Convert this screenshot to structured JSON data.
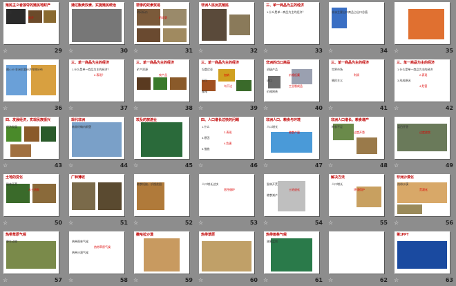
{
  "slides": [
    {
      "n": "29",
      "title": "殖民主义者掠夺的殖民地财产",
      "caps": [
        "黄金",
        "象牙"
      ]
    },
    {
      "n": "30",
      "title": "通过贩卖奴隶，实施殖民统治",
      "caps": []
    },
    {
      "n": "31",
      "title": "悲惨的奴隶贸易",
      "caps": [
        "明码标价",
        "的奴隶"
      ]
    },
    {
      "n": "32",
      "title": "非洲人民反抗殖民",
      "caps": []
    },
    {
      "n": "33",
      "title": "三、单一商品为主的经济",
      "caps": [
        "1.什么是单一商品为主的经济？"
      ]
    },
    {
      "n": "34",
      "title": "",
      "caps": [
        "非洲主要出口商品占出口总值"
      ]
    },
    {
      "n": "35",
      "title": "",
      "caps": []
    },
    {
      "n": "36",
      "title": "",
      "caps": [
        "图4.49 非洲主要经济作物分布"
      ]
    },
    {
      "n": "37",
      "title": "三、单一商品为主的经济",
      "caps": [
        "1.什么是单一商品为主的经济？",
        "2.表现？"
      ]
    },
    {
      "n": "38",
      "title": "三、单一商品为主的经济",
      "caps": [
        "矿产资源",
        "农产品"
      ]
    },
    {
      "n": "39",
      "title": "三、单一商品为主的经济",
      "caps": [
        "坦桑尼亚",
        "加纳",
        "可可",
        "乌干达",
        "咖啡"
      ]
    },
    {
      "n": "40",
      "title": "非洲的出口商品",
      "caps": [
        "初级产品",
        "价格低廉",
        "进口",
        "工业制成品",
        "价格昂贵"
      ]
    },
    {
      "n": "41",
      "title": "三、单一商品为主的经济",
      "caps": [
        "世界市场",
        "利润",
        "殖民主义"
      ]
    },
    {
      "n": "42",
      "title": "三、单一商品为主的经济",
      "caps": [
        "1.什么是单一商品为主的经济",
        "2.表现",
        "3.形成原因",
        "4.危害"
      ]
    },
    {
      "n": "43",
      "title": "四、发展经济，实现民族振兴",
      "caps": [
        "经济发展"
      ]
    },
    {
      "n": "44",
      "title": "现代非洲",
      "caps": [
        "南非约翰内斯堡"
      ]
    },
    {
      "n": "45",
      "title": "埃及的旅游业",
      "caps": []
    },
    {
      "n": "46",
      "title": "四、人口增长过快的问题",
      "caps": [
        "1.什么",
        "2.表现",
        "3.原因",
        "4.危害",
        "5.措施"
      ]
    },
    {
      "n": "47",
      "title": "非洲人口、粮食与环境",
      "caps": [
        "人口增长",
        "粮食产量"
      ]
    },
    {
      "n": "48",
      "title": "非洲人口增长、粮食增产",
      "caps": [
        "粮食不足",
        "过度开垦"
      ]
    },
    {
      "n": "49",
      "title": "",
      "caps": [
        "盲目开垦",
        "过度放牧"
      ]
    },
    {
      "n": "50",
      "title": "土地的变化",
      "caps": [
        "毁林开荒",
        "水土流失"
      ]
    },
    {
      "n": "51",
      "title": "广种薄收",
      "caps": []
    },
    {
      "n": "52",
      "title": "",
      "caps": [
        "粮食短缺、饥饿贫困"
      ]
    },
    {
      "n": "53",
      "title": "",
      "caps": [
        "人口增长过快",
        "恶性循环"
      ]
    },
    {
      "n": "54",
      "title": "",
      "caps": [
        "毁林开荒",
        "土地退化",
        "粮食减产"
      ]
    },
    {
      "n": "55",
      "title": "解决方法",
      "caps": [
        "人口增长",
        "环境保护"
      ]
    },
    {
      "n": "56",
      "title": "非洲沙漠化",
      "caps": [
        "热带沙漠",
        "荒漠化"
      ]
    },
    {
      "n": "57",
      "title": "热带草原气候",
      "caps": [
        "野生动物"
      ]
    },
    {
      "n": "58",
      "title": "",
      "caps": [
        "热带雨林气候",
        "热带草原气候",
        "热带沙漠气候"
      ]
    },
    {
      "n": "59",
      "title": "撒哈拉沙漠",
      "caps": []
    },
    {
      "n": "60",
      "title": "热带草原",
      "caps": []
    },
    {
      "n": "61",
      "title": "热带雨林气候",
      "caps": [
        "刚果盆地"
      ]
    },
    {
      "n": "62",
      "title": "",
      "caps": []
    },
    {
      "n": "63",
      "title": "第1PPT",
      "caps": []
    }
  ]
}
